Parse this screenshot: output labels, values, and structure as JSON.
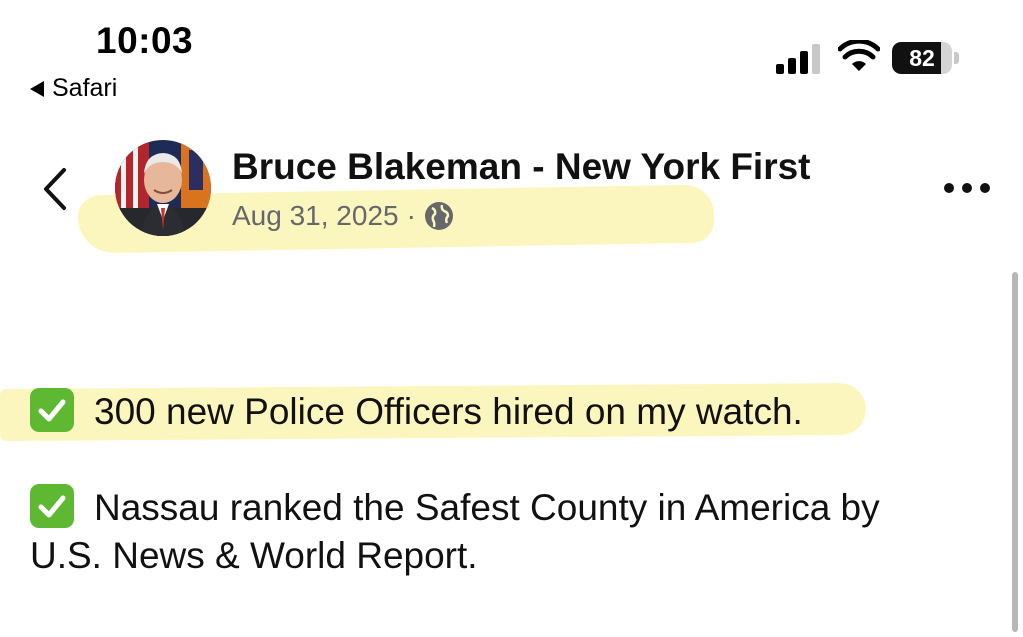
{
  "status_bar": {
    "time": "10:03",
    "back_app": "Safari",
    "battery_level": "82",
    "battery_fraction": 0.82
  },
  "header": {
    "page_name": "Bruce Blakeman - New York First",
    "date": "Aug 31, 2025",
    "separator": "·",
    "audience_icon": "globe-icon",
    "more_icon": "more-icon",
    "back_icon": "chevron-left-icon"
  },
  "post": {
    "paragraphs": [
      "300 new Police Officers hired on my watch.",
      "Nassau ranked the Safest County in America by",
      "U.S. News & World Report."
    ],
    "check_icon": "check-mark-button-icon"
  },
  "colors": {
    "highlight": "#fbf6bd",
    "check_green": "#5fb832",
    "meta_gray": "#65676b"
  }
}
